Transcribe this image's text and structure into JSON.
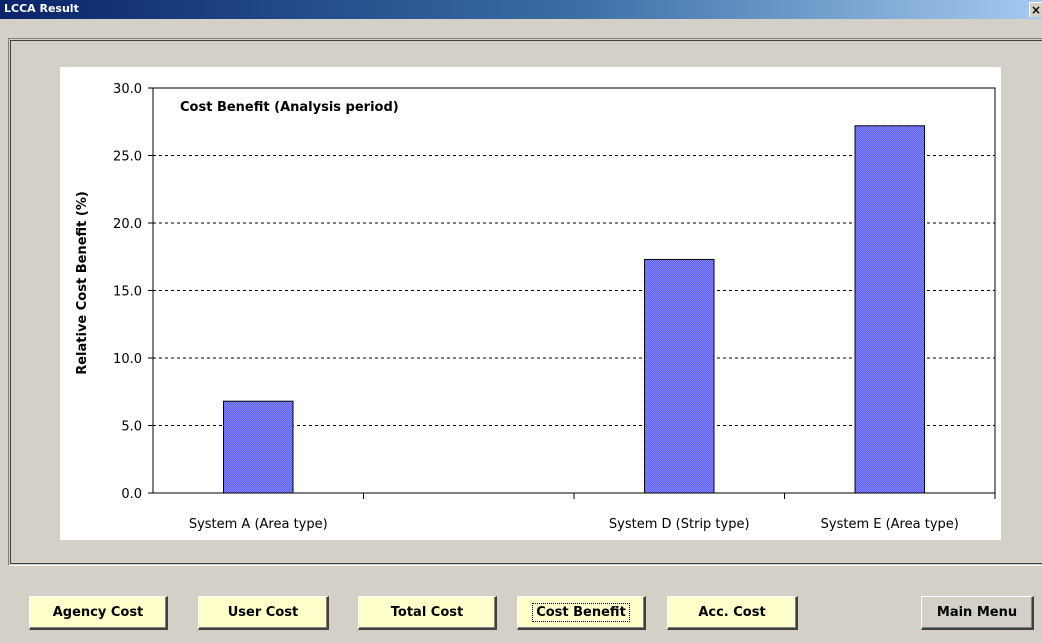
{
  "window": {
    "title": "LCCA Result",
    "close_glyph": "×"
  },
  "buttons": {
    "agency": "Agency Cost",
    "user": "User Cost",
    "total": "Total Cost",
    "benefit": "Cost Benefit",
    "acc": "Acc. Cost",
    "main": "Main Menu"
  },
  "colors": {
    "bar_fill": "#7f7fff",
    "button_bg": "#ffffcc",
    "title_bar": "#0a246a"
  },
  "chart_data": {
    "type": "bar",
    "title": "Cost Benefit (Analysis period)",
    "xlabel": "",
    "ylabel": "Relative Cost Benefit  (%)",
    "categories": [
      "System A (Area type)",
      "",
      "System D (Strip type)",
      "System E (Area type)"
    ],
    "values": [
      6.8,
      null,
      17.3,
      27.2
    ],
    "ylim": [
      0,
      30
    ],
    "yticks": [
      "0.0",
      "5.0",
      "10.0",
      "15.0",
      "20.0",
      "25.0",
      "30.0"
    ],
    "grid": true
  }
}
